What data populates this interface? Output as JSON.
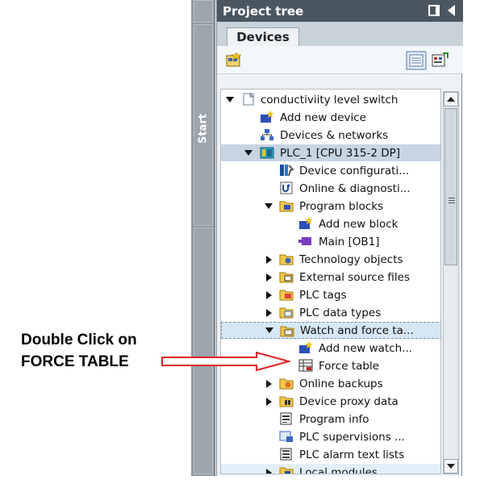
{
  "sidebar": {
    "start_label": "Start"
  },
  "panel": {
    "title": "Project tree",
    "tab_label": "Devices"
  },
  "tree": {
    "items": [
      {
        "label": "conductiviity level switch",
        "icon": "project-icon",
        "expanded": true
      },
      {
        "label": "Add new device",
        "icon": "add-device-icon"
      },
      {
        "label": "Devices & networks",
        "icon": "network-icon"
      },
      {
        "label": "PLC_1 [CPU 315-2 DP]",
        "icon": "plc-icon",
        "expanded": true,
        "selected": true
      },
      {
        "label": "Device configurati...",
        "icon": "device-config-icon"
      },
      {
        "label": "Online & diagnosti...",
        "icon": "diagnostics-icon"
      },
      {
        "label": "Program blocks",
        "icon": "folder-icon",
        "expanded": true
      },
      {
        "label": "Add new block",
        "icon": "add-block-icon"
      },
      {
        "label": "Main [OB1]",
        "icon": "ob-block-icon"
      },
      {
        "label": "Technology objects",
        "icon": "folder-icon",
        "expanded": false
      },
      {
        "label": "External source files",
        "icon": "folder-icon",
        "expanded": false
      },
      {
        "label": "PLC tags",
        "icon": "folder-icon",
        "expanded": false
      },
      {
        "label": "PLC data types",
        "icon": "folder-icon",
        "expanded": false
      },
      {
        "label": "Watch and force ta...",
        "icon": "folder-icon",
        "expanded": true,
        "hover": true
      },
      {
        "label": "Add new watch...",
        "icon": "add-watch-icon"
      },
      {
        "label": "Force table",
        "icon": "force-table-icon"
      },
      {
        "label": "Online backups",
        "icon": "folder-icon",
        "expanded": false
      },
      {
        "label": "Device proxy data",
        "icon": "folder-icon",
        "expanded": false
      },
      {
        "label": "Program info",
        "icon": "program-info-icon"
      },
      {
        "label": "PLC supervisions ...",
        "icon": "supervision-icon"
      },
      {
        "label": "PLC alarm text lists",
        "icon": "alarm-list-icon"
      },
      {
        "label": "Local modules",
        "icon": "folder-icon",
        "expanded": false
      }
    ]
  },
  "annotation": {
    "line1": "Double Click on",
    "line2": "FORCE TABLE"
  },
  "colors": {
    "header": "#4a5761",
    "arrow": "#e02020",
    "selected": "#c7d5e2",
    "hover": "#d6e7f5"
  }
}
